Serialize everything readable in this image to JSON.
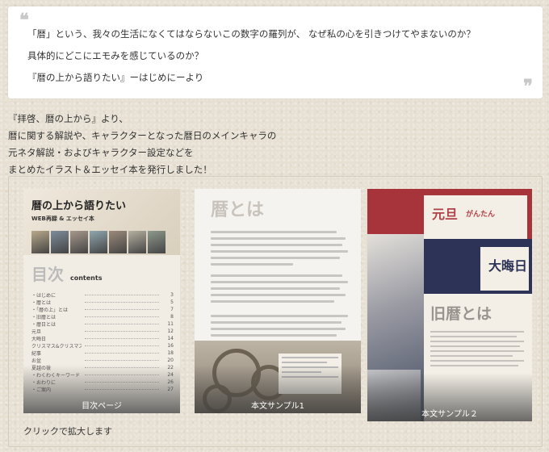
{
  "quote": {
    "open_mark": "❝",
    "close_mark": "❞",
    "lines": [
      "「暦」という、我々の生活になくてはならないこの数字の羅列が、 なぜ私の心を引きつけてやまないのか？",
      "具体的にどこにエモみを感じているのか？",
      "『暦の上から語りたい』ーはじめにーより"
    ]
  },
  "body_lines": [
    "『拝啓、暦の上から』より、",
    "暦に関する解説や、キャラクターとなった暦日のメインキャラの",
    "元ネタ解説・およびキャラクター設定などを",
    "まとめたイラスト＆エッセイ本を発行しました！"
  ],
  "gallery": {
    "thumbs": [
      {
        "caption": "目次ページ",
        "book_title": "暦の上から語りたい",
        "book_subtitle": "WEB再録 & エッセイ本",
        "toc_title": "目次",
        "toc_subtitle": "contents",
        "toc_items": [
          {
            "label": "・はじめに",
            "page": "3"
          },
          {
            "label": "・暦とは",
            "page": "5"
          },
          {
            "label": "・「暦の上」とは",
            "page": "7"
          },
          {
            "label": "・旧暦とは",
            "page": "8"
          },
          {
            "label": "・暦日とは",
            "page": "11"
          },
          {
            "label": "元旦",
            "page": "12"
          },
          {
            "label": "大晦日",
            "page": "14"
          },
          {
            "label": "クリスマス&クリスマスイブ",
            "page": "16"
          },
          {
            "label": "紀事",
            "page": "18"
          },
          {
            "label": "お盆",
            "page": "20"
          },
          {
            "label": "夏越の祓",
            "page": "22"
          },
          {
            "label": "・わくわくキーワード",
            "page": "24"
          },
          {
            "label": "・おわりに",
            "page": "26"
          },
          {
            "label": "・ご案内",
            "page": "27"
          }
        ],
        "portrait_colors": [
          "#b8a98a",
          "#7d8c9b",
          "#a6998c",
          "#8fa7b0",
          "#9c8a7a",
          "#b5b0a0",
          "#8e9a8c"
        ]
      },
      {
        "caption": "本文サンプル1",
        "heading": "暦とは"
      },
      {
        "caption": "本文サンプル２",
        "label_1": "元旦",
        "label_1_reading": "がんたん",
        "label_2": "大晦日",
        "label_3": "旧暦とは"
      }
    ],
    "hint": "クリックで拡大します"
  },
  "colors": {
    "background": "#e6dfd2",
    "quote_bg": "#ffffff",
    "sample_red": "#a8343b",
    "sample_navy": "#2d3356"
  }
}
